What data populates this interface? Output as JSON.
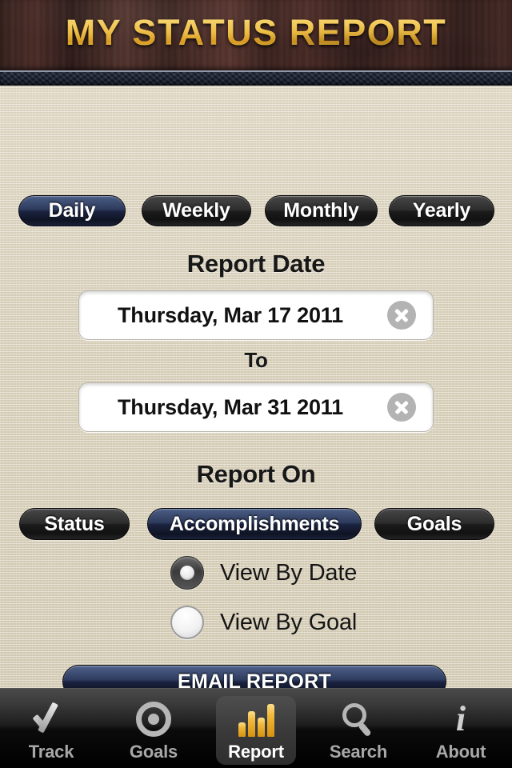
{
  "header": {
    "title": "MY STATUS REPORT"
  },
  "period_tabs": {
    "items": [
      {
        "label": "Daily",
        "selected": true
      },
      {
        "label": "Weekly",
        "selected": false
      },
      {
        "label": "Monthly",
        "selected": false
      },
      {
        "label": "Yearly",
        "selected": false
      }
    ]
  },
  "report_date": {
    "heading": "Report Date",
    "from_value": "Thursday, Mar 17 2011",
    "to_heading": "To",
    "to_value": "Thursday, Mar 31 2011",
    "clear_icon": "close-circle-icon"
  },
  "report_on": {
    "heading": "Report On",
    "items": [
      {
        "label": "Status",
        "selected": false
      },
      {
        "label": "Accomplishments",
        "selected": true
      },
      {
        "label": "Goals",
        "selected": false
      }
    ]
  },
  "view_options": {
    "items": [
      {
        "label": "View By Date",
        "selected": true
      },
      {
        "label": "View By Goal",
        "selected": false
      }
    ]
  },
  "actions": {
    "email_report": "EMAIL REPORT"
  },
  "tabbar": {
    "items": [
      {
        "label": "Track",
        "icon": "checkmark-icon",
        "active": false
      },
      {
        "label": "Goals",
        "icon": "bullseye-icon",
        "active": false
      },
      {
        "label": "Report",
        "icon": "bar-chart-icon",
        "active": true
      },
      {
        "label": "Search",
        "icon": "magnifier-icon",
        "active": false
      },
      {
        "label": "About",
        "icon": "info-icon",
        "active": false
      }
    ]
  },
  "colors": {
    "selected_button": "#2d3b5c",
    "unselected_button": "#2c2c2c",
    "background_linen": "#e2dbc7",
    "title_gold": "#eebd44",
    "wood_brown": "#3e2521",
    "leather_navy": "#1b2335",
    "report_icon_gold": "#f0b83c"
  }
}
